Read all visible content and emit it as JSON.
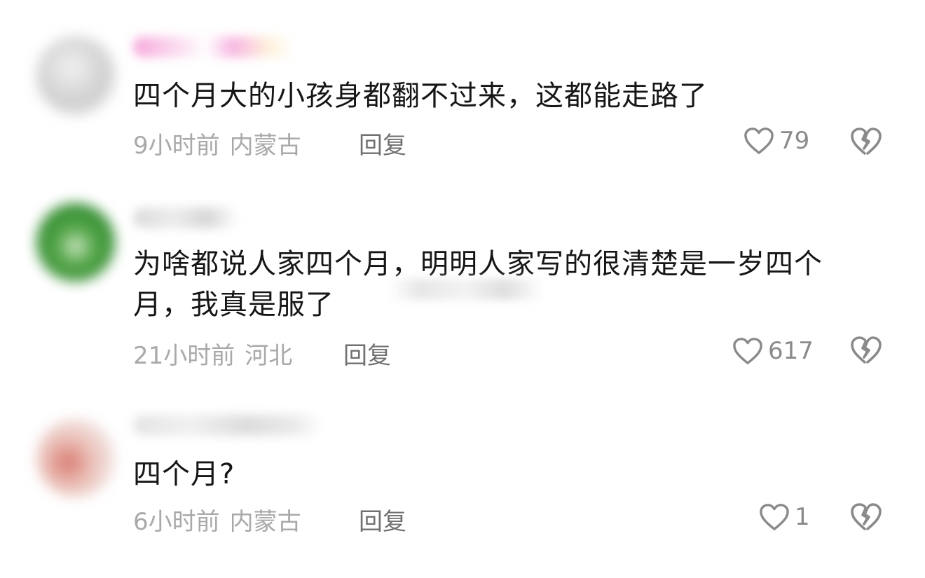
{
  "comments": [
    {
      "text": "四个月大的小孩身都翻不过来，这都能走路了",
      "time": "9小时前",
      "location": "内蒙古",
      "reply_label": "回复",
      "likes": "79",
      "avatar_color": "#d9d9d9",
      "name_color": "#f6a6da"
    },
    {
      "text": "为啥都说人家四个月，明明人家写的很清楚是一岁四个月，我真是服了",
      "time": "21小时前",
      "location": "河北",
      "reply_label": "回复",
      "likes": "617",
      "avatar_color": "#3f9a3a",
      "name_color": "#d8d8d8"
    },
    {
      "text": "四个月?",
      "time": "6小时前",
      "location": "内蒙古",
      "reply_label": "回复",
      "likes": "1",
      "avatar_color": "#e8c7c2",
      "name_color": "#e0e0e0"
    }
  ],
  "icons": {
    "like": "heart-outline-icon",
    "dislike": "broken-heart-icon"
  },
  "colors": {
    "text": "#161616",
    "meta": "#a9a9a9",
    "reply": "#707070",
    "icon": "#8a8a8a"
  }
}
